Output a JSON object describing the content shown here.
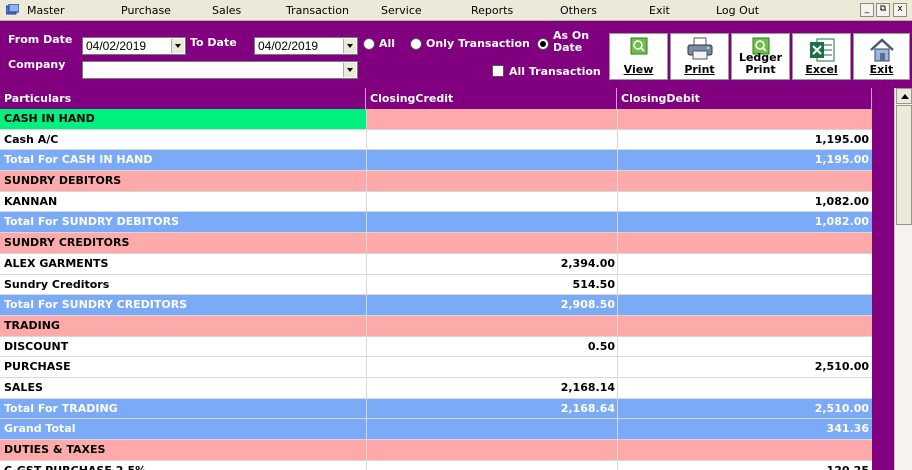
{
  "menu": {
    "items": [
      "Master",
      "Purchase",
      "Sales",
      "Transaction",
      "Service",
      "Reports",
      "Others",
      "Exit",
      "Log Out"
    ],
    "window_buttons": [
      "_",
      "⧉",
      "x"
    ]
  },
  "filters": {
    "from_date_label": "From Date",
    "from_date": "04/02/2019",
    "to_date_label": "To Date",
    "to_date": "04/02/2019",
    "company_label": "Company",
    "company": "",
    "radio_all": "All",
    "radio_only_transaction": "Only Transaction",
    "radio_as_on_date": "As On Date",
    "selected_radio": "as_on_date",
    "all_transaction_label": "All Transaction",
    "all_transaction_checked": false
  },
  "toolbar": {
    "view": "View",
    "print": "Print",
    "ledger_print_line1": "Ledger",
    "ledger_print_line2": "Print",
    "excel": "Excel",
    "exit": "Exit"
  },
  "grid": {
    "columns": [
      "Particulars",
      "ClosingCredit",
      "ClosingDebit"
    ],
    "rows": [
      {
        "type": "group",
        "particulars": "CASH IN HAND",
        "credit": "",
        "debit": ""
      },
      {
        "type": "item",
        "particulars": "Cash A/C",
        "credit": "",
        "debit": "1,195.00"
      },
      {
        "type": "total",
        "particulars": "Total For CASH IN HAND",
        "credit": "",
        "debit": "1,195.00"
      },
      {
        "type": "group",
        "particulars": "SUNDRY DEBITORS",
        "credit": "",
        "debit": ""
      },
      {
        "type": "item",
        "particulars": "KANNAN",
        "credit": "",
        "debit": "1,082.00"
      },
      {
        "type": "total",
        "particulars": "Total For SUNDRY DEBITORS",
        "credit": "",
        "debit": "1,082.00"
      },
      {
        "type": "group",
        "particulars": "SUNDRY CREDITORS",
        "credit": "",
        "debit": ""
      },
      {
        "type": "item",
        "particulars": "ALEX GARMENTS",
        "credit": "2,394.00",
        "debit": ""
      },
      {
        "type": "item",
        "particulars": "Sundry Creditors",
        "credit": "514.50",
        "debit": ""
      },
      {
        "type": "total",
        "particulars": "Total For SUNDRY CREDITORS",
        "credit": "2,908.50",
        "debit": ""
      },
      {
        "type": "group",
        "particulars": "TRADING",
        "credit": "",
        "debit": ""
      },
      {
        "type": "item",
        "particulars": "DISCOUNT",
        "credit": "0.50",
        "debit": ""
      },
      {
        "type": "item",
        "particulars": "PURCHASE",
        "credit": "",
        "debit": "2,510.00"
      },
      {
        "type": "item",
        "particulars": "SALES",
        "credit": "2,168.14",
        "debit": ""
      },
      {
        "type": "total",
        "particulars": "Total For TRADING",
        "credit": "2,168.64",
        "debit": "2,510.00"
      },
      {
        "type": "total",
        "particulars": "Grand Total",
        "credit": "",
        "debit": "341.36"
      },
      {
        "type": "group",
        "particulars": "DUTIES & TAXES",
        "credit": "",
        "debit": ""
      },
      {
        "type": "item",
        "particulars": "C-GST PURCHASE 2.5%",
        "credit": "",
        "debit": "120.25"
      }
    ]
  },
  "colors": {
    "panel_bg": "#800080",
    "group_row": "#ffaaaa",
    "first_group_cell": "#00f080",
    "total_row": "#7baaf7"
  }
}
